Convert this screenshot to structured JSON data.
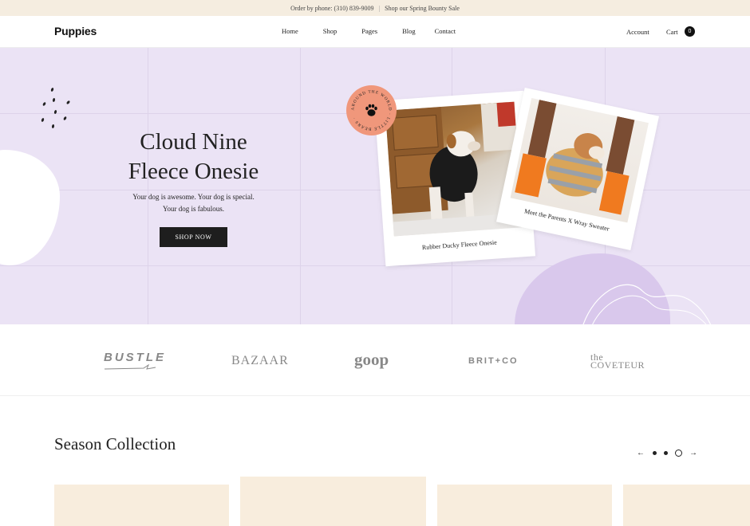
{
  "topbar": {
    "phone": "Order by phone: (310) 839-9009",
    "sale": "Shop our Spring Bounty Sale",
    "sep": "|"
  },
  "header": {
    "logo": "Puppies",
    "nav": [
      "Home",
      "Shop",
      "Pages",
      "Blog",
      "Contact"
    ],
    "account": "Account",
    "cart": "Cart",
    "cart_count": "0"
  },
  "hero": {
    "title_line1": "Cloud Nine",
    "title_line2": "Fleece Onesie",
    "sub_line1": "Your dog is awesome. Your dog is special.",
    "sub_line2": "Your dog is fabulous.",
    "cta": "SHOP NOW",
    "badge_text": "AROUND THE WORLD · LITTLE BEARS ·",
    "photo1_caption": "Rubber Ducky Fleece Onesie",
    "photo2_caption": "Meet the Parents X Wray Sweater"
  },
  "press": {
    "brands": [
      "BUSTLE",
      "BAZAAR",
      "goop",
      "BRIT+CO",
      "the COVETEUR"
    ]
  },
  "collection": {
    "title": "Season Collection",
    "prev": "←",
    "next": "→"
  },
  "colors": {
    "hero_bg": "#ebe3f5",
    "topbar_bg": "#f5ede0",
    "badge": "#f0977b",
    "button": "#1e1e1e"
  }
}
